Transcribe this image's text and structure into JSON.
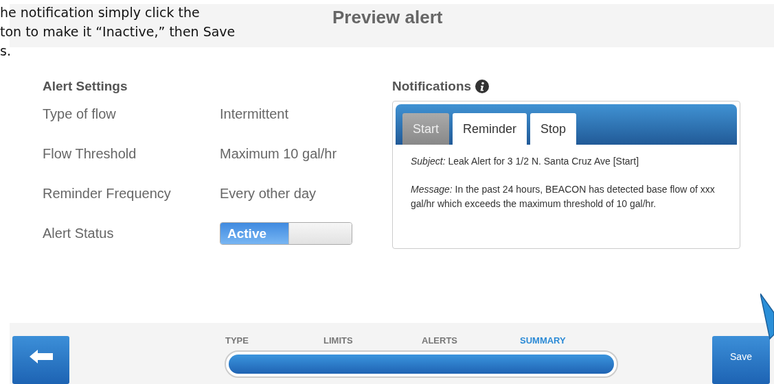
{
  "instruction_lines": [
    "he notification simply click the",
    "ton to make it “Inactive,” then Save",
    "s."
  ],
  "title": "Preview alert",
  "alert_settings": {
    "heading": "Alert Settings",
    "rows": [
      {
        "label": "Type of flow",
        "value": "Intermittent",
        "kind": "text"
      },
      {
        "label": "Flow Threshold",
        "value": "Maximum 10 gal/hr",
        "kind": "text"
      },
      {
        "label": "Reminder Frequency",
        "value": "Every other day",
        "kind": "text"
      },
      {
        "label": "Alert Status",
        "value": "Active",
        "kind": "toggle",
        "on": true
      }
    ]
  },
  "notifications": {
    "heading": "Notifications",
    "tabs": [
      {
        "label": "Start",
        "selected": true
      },
      {
        "label": "Reminder",
        "selected": false
      },
      {
        "label": "Stop",
        "selected": false
      }
    ],
    "subject_label": "Subject:",
    "subject": "Leak Alert for 3 1/2 N. Santa Cruz Ave [Start]",
    "message_label": "Message:",
    "message": "In the past 24 hours, BEACON has detected base flow of xxx gal/hr which exceeds the maximum threshold of 10 gal/hr."
  },
  "footer": {
    "steps": [
      {
        "label": "TYPE",
        "selected": false
      },
      {
        "label": "LIMITS",
        "selected": false
      },
      {
        "label": "ALERTS",
        "selected": false
      },
      {
        "label": "SUMMARY",
        "selected": true
      }
    ],
    "progress": {
      "level": 1
    },
    "save_button": "Save"
  }
}
